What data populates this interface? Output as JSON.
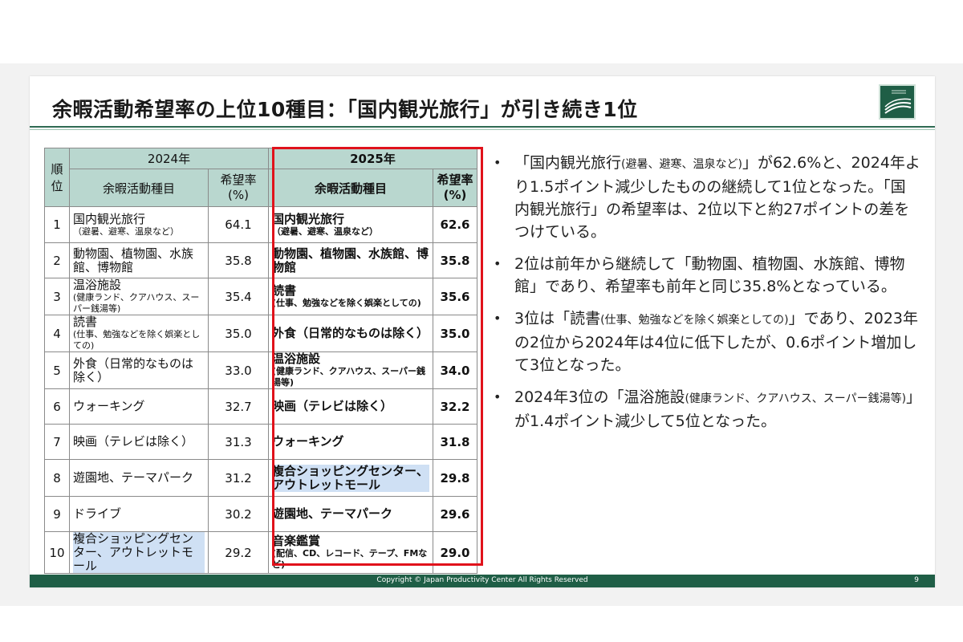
{
  "title": "余暇活動希望率の上位10種目：「国内観光旅行」が引き続き1位",
  "table": {
    "rank_header": "順\n位",
    "y2024_header": "2024年",
    "y2025_header": "2025年",
    "activity_header": "余暇活動種目",
    "rate_header": "希望率\n(%)",
    "rows": [
      {
        "rank": "1",
        "a2024": "国内観光旅行",
        "s2024": "（避暑、避寒、温泉など）",
        "v2024": "64.1",
        "a2025": "国内観光旅行",
        "s2025": "（避暑、避寒、温泉など）",
        "v2025": "62.6"
      },
      {
        "rank": "2",
        "a2024": "動物園、植物園、水族館、博物館",
        "s2024": "",
        "v2024": "35.8",
        "a2025": "動物園、植物園、水族館、博物館",
        "s2025": "",
        "v2025": "35.8"
      },
      {
        "rank": "3",
        "a2024": "温浴施設",
        "s2024": "(健康ランド、クアハウス、スーパー銭湯等)",
        "v2024": "35.4",
        "a2025": "読書",
        "s2025": "(仕事、勉強などを除く娯楽としての)",
        "v2025": "35.6"
      },
      {
        "rank": "4",
        "a2024": "読書",
        "s2024": "(仕事、勉強などを除く娯楽としての)",
        "v2024": "35.0",
        "a2025": "外食（日常的なものは除く）",
        "s2025": "",
        "v2025": "35.0"
      },
      {
        "rank": "5",
        "a2024": "外食（日常的なものは除く）",
        "s2024": "",
        "v2024": "33.0",
        "a2025": "温浴施設",
        "s2025": "(健康ランド、クアハウス、スーパー銭湯等)",
        "v2025": "34.0"
      },
      {
        "rank": "6",
        "a2024": "ウォーキング",
        "s2024": "",
        "v2024": "32.7",
        "a2025": "映画（テレビは除く）",
        "s2025": "",
        "v2025": "32.2"
      },
      {
        "rank": "7",
        "a2024": "映画（テレビは除く）",
        "s2024": "",
        "v2024": "31.3",
        "a2025": "ウォーキング",
        "s2025": "",
        "v2025": "31.8"
      },
      {
        "rank": "8",
        "a2024": "遊園地、テーマパーク",
        "s2024": "",
        "v2024": "31.2",
        "a2025": "複合ショッピングセンター、アウトレットモール",
        "s2025": "",
        "v2025": "29.8"
      },
      {
        "rank": "9",
        "a2024": "ドライブ",
        "s2024": "",
        "v2024": "30.2",
        "a2025": "遊園地、テーマパーク",
        "s2025": "",
        "v2025": "29.6"
      },
      {
        "rank": "10",
        "a2024": "複合ショッピングセンター、アウトレットモール",
        "s2024": "",
        "v2024": "29.2",
        "a2025": "音楽鑑賞",
        "s2025": "(配信、CD、レコード、テープ、FMなど)",
        "v2025": "29.0"
      }
    ]
  },
  "bullets": [
    {
      "pre": "「国内観光旅行",
      "small": "(避暑、避寒、温泉など)",
      "post": "」が62.6%と、2024年より1.5ポイント減少したものの継続して1位となった。「国内観光旅行」の希望率は、2位以下と約27ポイントの差をつけている。"
    },
    {
      "pre": "2位は前年から継続して「動物園、植物園、水族館、博物館」であり、希望率も前年と同じ35.8%となっている。",
      "small": "",
      "post": ""
    },
    {
      "pre": "3位は「読書",
      "small": "(仕事、勉強などを除く娯楽としての)",
      "post": "」であり、2023年の2位から2024年は4位に低下したが、0.6ポイント増加して3位となった。"
    },
    {
      "pre": "2024年3位の「温浴施設",
      "small": "(健康ランド、クアハウス、スーパー銭湯等)",
      "post": "」が1.4ポイント減少して5位となった。"
    }
  ],
  "footer": {
    "copyright": "Copyright © Japan Productivity Center All Rights Reserved",
    "page": "9"
  },
  "logo": {
    "icon": "jpc-logo-icon",
    "color": "#1f5e46",
    "text": "JAPAN PRODUCTIVITY CENTER"
  }
}
